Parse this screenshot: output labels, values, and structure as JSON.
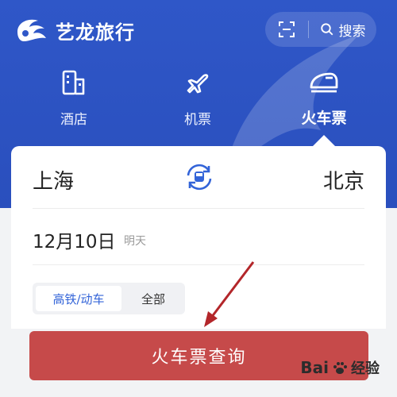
{
  "app": {
    "title": "艺龙旅行"
  },
  "topbar": {
    "search_label": "搜索",
    "scan_icon": "scan-icon",
    "search_icon": "search-icon"
  },
  "tabs": [
    {
      "label": "酒店",
      "icon": "hotel-icon"
    },
    {
      "label": "机票",
      "icon": "plane-icon"
    },
    {
      "label": "火车票",
      "icon": "train-icon",
      "active": true
    }
  ],
  "route": {
    "from": "上海",
    "to": "北京",
    "swap_icon": "swap-train-icon"
  },
  "date": {
    "value": "12月10日",
    "hint": "明天"
  },
  "filter": {
    "options": [
      "高铁/动车",
      "全部"
    ],
    "selected": "高铁/动车"
  },
  "search_button": {
    "label": "火车票查询"
  },
  "watermark": {
    "text_a": "Bai",
    "text_b": "经验"
  },
  "colors": {
    "brand_blue": "#2f57c8",
    "accent_blue": "#3364d8",
    "search_red": "#c64a4a",
    "arrow_red": "#b3262a"
  }
}
